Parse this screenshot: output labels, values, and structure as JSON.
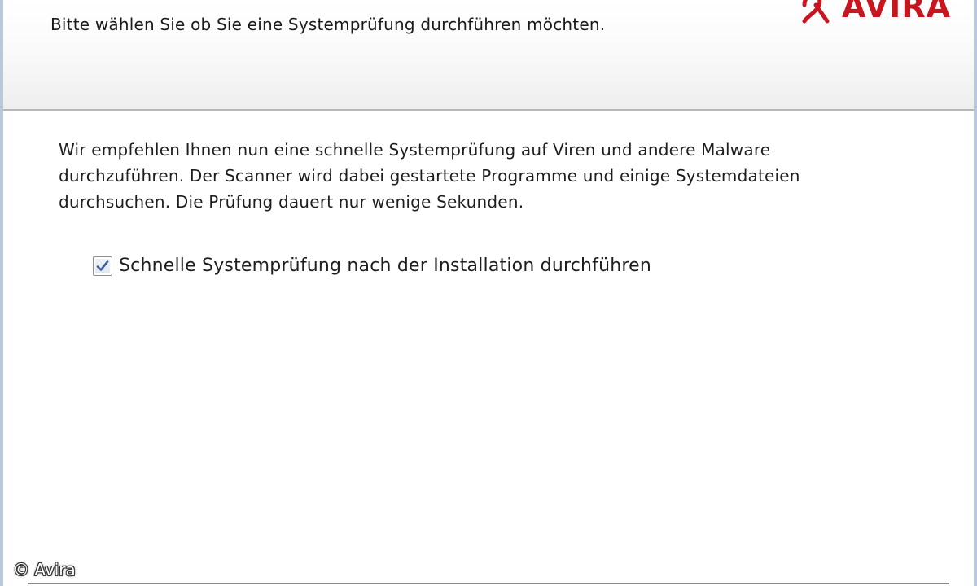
{
  "header": {
    "instruction": "Bitte wählen Sie ob Sie eine Systemprüfung durchführen möchten.",
    "logo_text": "AVIRA"
  },
  "body": {
    "paragraph_lines": [
      "Wir empfehlen Ihnen nun eine schnelle Systemprüfung auf Viren und andere Malware",
      "durchzuführen. Der Scanner wird dabei gestartete Programme und einige Systemdateien",
      "durchsuchen. Die Prüfung dauert nur wenige Sekunden."
    ]
  },
  "options": {
    "quick_scan": {
      "label": "Schnelle Systemprüfung nach der Installation durchführen",
      "checked": true
    }
  },
  "watermark": "© Avira",
  "colors": {
    "brand": "#c9151e",
    "window_border": "#b9c9db",
    "checkmark": "#3a5a9a"
  },
  "icons": {
    "logo": "avira-umbrella-icon",
    "check": "checkmark-icon"
  }
}
